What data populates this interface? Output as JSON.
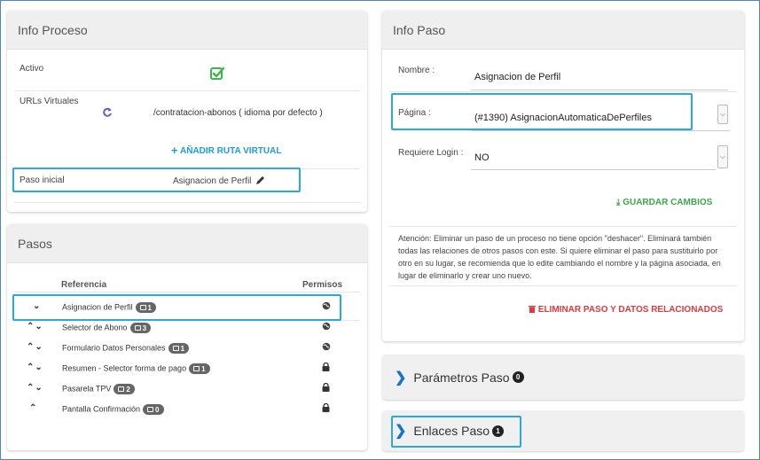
{
  "info_proceso": {
    "title": "Info Proceso",
    "activo_label": "Activo",
    "urls_label": "URLs Virtuales",
    "url_value": "/contratacion-abonos ( idioma por defecto )",
    "add_route_label": "AÑADIR RUTA VIRTUAL",
    "paso_inicial_label": "Paso inicial",
    "paso_inicial_value": "Asignacion de Perfil"
  },
  "pasos": {
    "title": "Pasos",
    "col_referencia": "Referencia",
    "col_permisos": "Permisos",
    "rows": [
      {
        "name": "Asignacion de Perfil",
        "badge": "1",
        "arrows": "down",
        "perm": "globe"
      },
      {
        "name": "Selector de Abono",
        "badge": "3",
        "arrows": "updown",
        "perm": "globe"
      },
      {
        "name": "Formulario Datos Personales",
        "badge": "1",
        "arrows": "updown",
        "perm": "globe"
      },
      {
        "name": "Resumen - Selector forma de pago",
        "badge": "1",
        "arrows": "updown",
        "perm": "lock"
      },
      {
        "name": "Pasarela TPV",
        "badge": "2",
        "arrows": "updown",
        "perm": "lock"
      },
      {
        "name": "Pantalla Confirmación",
        "badge": "0",
        "arrows": "up",
        "perm": "lock"
      }
    ]
  },
  "info_paso": {
    "title": "Info Paso",
    "nombre_label": "Nombre :",
    "nombre_value": "Asignacion de Perfil",
    "pagina_label": "Página :",
    "pagina_value": "(#1390) AsignacionAutomaticaDePerfiles",
    "login_label": "Requiere Login :",
    "login_value": "NO",
    "save_label": "GUARDAR CAMBIOS",
    "warning_text": "Atención: Eliminar un paso de un proceso no tiene opción \"deshacer\". Eliminará también todas las relaciones de otros pasos con este. Si quiere eliminar el paso para sustituirlo por otro en su lugar, se recomienda que lo edite cambiando el nombre y la página asociada, en lugar de eliminarlo y crear uno nuevo.",
    "delete_label": "ELIMINAR PASO Y DATOS RELACIONADOS"
  },
  "parametros": {
    "label": "Parámetros Paso",
    "count": "0"
  },
  "enlaces": {
    "label": "Enlaces Paso",
    "count": "1"
  },
  "colors": {
    "accent_blue": "#2aa8e0",
    "green": "#3aa84a",
    "red": "#e2393d"
  }
}
